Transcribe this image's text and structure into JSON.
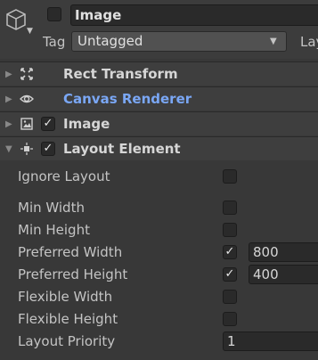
{
  "gameobject": {
    "name": "Image",
    "tag_label": "Tag",
    "tag_value": "Untagged",
    "layer_label": "Lay"
  },
  "components": [
    {
      "title": "Rect Transform",
      "icon": "rect-transform-icon",
      "has_checkbox": false
    },
    {
      "title": "Canvas Renderer",
      "icon": "eye-icon",
      "has_checkbox": false
    },
    {
      "title": "Image",
      "icon": "image-icon",
      "has_checkbox": true,
      "checked": true
    },
    {
      "title": "Layout Element",
      "icon": "layout-element-icon",
      "has_checkbox": true,
      "checked": true,
      "expanded": true
    }
  ],
  "layout_element": {
    "ignore_layout": {
      "label": "Ignore Layout",
      "checked": false
    },
    "min_width": {
      "label": "Min Width",
      "checked": false
    },
    "min_height": {
      "label": "Min Height",
      "checked": false
    },
    "preferred_width": {
      "label": "Preferred Width",
      "checked": true,
      "value": "800"
    },
    "preferred_height": {
      "label": "Preferred Height",
      "checked": true,
      "value": "400"
    },
    "flexible_width": {
      "label": "Flexible Width",
      "checked": false
    },
    "flexible_height": {
      "label": "Flexible Height",
      "checked": false
    },
    "layout_priority": {
      "label": "Layout Priority",
      "value": "1"
    }
  },
  "glyphs": {
    "check": "✓",
    "fold_closed": "▶",
    "fold_open": "▼",
    "dropdown": "▼",
    "caret": "▼"
  },
  "colors": {
    "background": "#383838",
    "component_header": "#3e3e3e",
    "field": "#2a2a2a",
    "highlight_blue": "#7aa7f5"
  }
}
